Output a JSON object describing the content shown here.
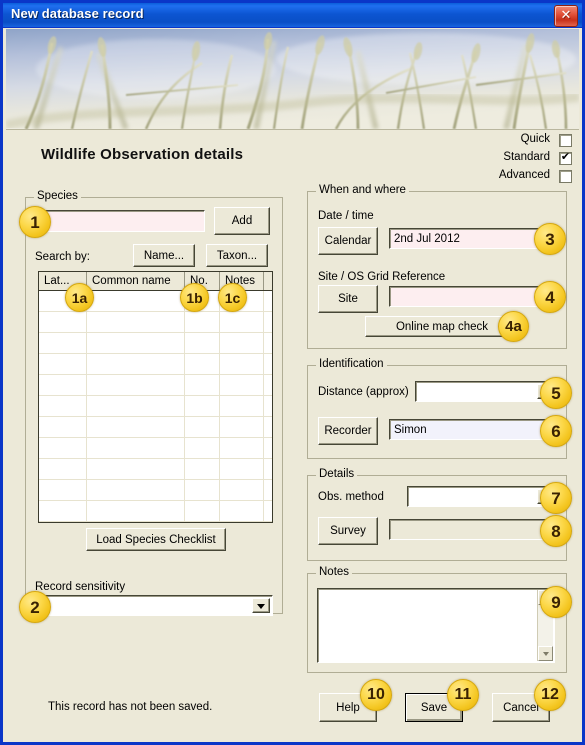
{
  "window": {
    "title": "New database record",
    "close_icon": "close-icon"
  },
  "headline": "Wildlife Observation details",
  "modes": [
    {
      "label": "Quick",
      "checked": false
    },
    {
      "label": "Standard",
      "checked": true
    },
    {
      "label": "Advanced",
      "checked": false
    }
  ],
  "species": {
    "group_title": "Species",
    "name_input_value": "",
    "add_button": "Add",
    "search_by_label": "Search by:",
    "name_button": "Name...",
    "taxon_button": "Taxon...",
    "columns": [
      "Lat...",
      "Common name",
      "No.",
      "Notes",
      ""
    ],
    "rows": [],
    "row_count": 17,
    "load_checklist_button": "Load Species Checklist",
    "sensitivity_label": "Record sensitivity",
    "sensitivity_value": ""
  },
  "when_and_where": {
    "group_title": "When and where",
    "date_time_label": "Date / time",
    "calendar_button": "Calendar",
    "date_value": "2nd Jul 2012",
    "site_grid_label": "Site / OS Grid Reference",
    "site_button": "Site",
    "site_value": "",
    "online_map_button": "Online map check"
  },
  "identification": {
    "group_title": "Identification",
    "distance_label": "Distance (approx)",
    "distance_value": "",
    "recorder_button": "Recorder",
    "recorder_value": "Simon"
  },
  "details": {
    "group_title": "Details",
    "obs_method_label": "Obs. method",
    "obs_method_value": "",
    "survey_button": "Survey",
    "survey_value": ""
  },
  "notes": {
    "group_title": "Notes",
    "value": ""
  },
  "footer": {
    "status": "This record has not been saved.",
    "help_button": "Help",
    "save_button": "Save",
    "cancel_button": "Cancel"
  },
  "badges": {
    "b1": "1",
    "b1a": "1a",
    "b1b": "1b",
    "b1c": "1c",
    "b2": "2",
    "b3": "3",
    "b4": "4",
    "b4a": "4a",
    "b5": "5",
    "b6": "6",
    "b7": "7",
    "b8": "8",
    "b9": "9",
    "b10": "10",
    "b11": "11",
    "b12": "12"
  },
  "colors": {
    "title_bar": "#0c55d2",
    "dialog_face": "#ece9d8",
    "badge": "#fcd84a",
    "required_field": "#fdeef0",
    "recorder_field": "#f2f2fb"
  }
}
